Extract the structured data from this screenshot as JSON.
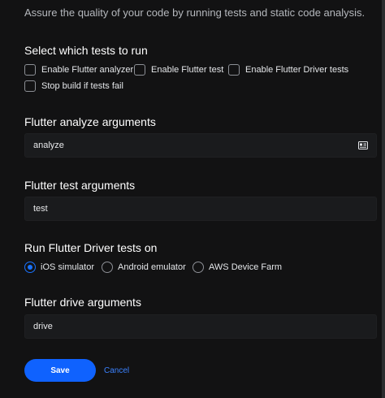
{
  "intro": "Assure the quality of your code by running tests and static code analysis.",
  "tests_section": {
    "title": "Select which tests to run",
    "checkboxes": [
      {
        "label": "Enable Flutter analyzer",
        "checked": false
      },
      {
        "label": "Enable Flutter test",
        "checked": false
      },
      {
        "label": "Enable Flutter Driver tests",
        "checked": false
      },
      {
        "label": "Stop build if tests fail",
        "checked": false
      }
    ]
  },
  "analyze": {
    "title": "Flutter analyze arguments",
    "value": "analyze",
    "icon": "card-icon"
  },
  "test": {
    "title": "Flutter test arguments",
    "value": "test"
  },
  "driver_target": {
    "title": "Run Flutter Driver tests on",
    "options": [
      {
        "label": "iOS simulator",
        "selected": true
      },
      {
        "label": "Android emulator",
        "selected": false
      },
      {
        "label": "AWS Device Farm",
        "selected": false
      }
    ]
  },
  "drive": {
    "title": "Flutter drive arguments",
    "value": "drive"
  },
  "actions": {
    "save_label": "Save",
    "cancel_label": "Cancel"
  },
  "colors": {
    "accent": "#0f62fe",
    "background": "#121213",
    "input_background": "#1a1b1d"
  }
}
